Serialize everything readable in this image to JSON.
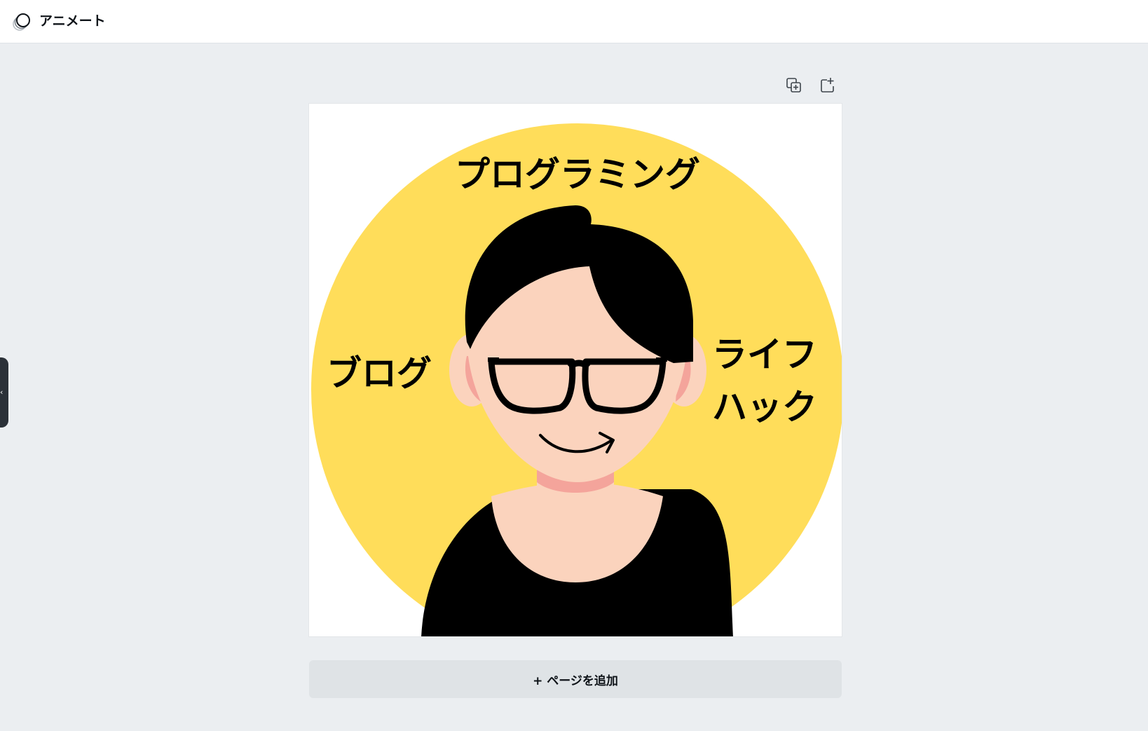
{
  "header": {
    "app_title": "アニメート",
    "logo_icon": "animate-logo-icon"
  },
  "sidebar": {
    "toggle_icon": "chevron-left-icon"
  },
  "page_toolbar": {
    "duplicate_icon": "duplicate-page-icon",
    "add_icon": "add-page-icon"
  },
  "design": {
    "text_top": "プログラミング",
    "text_left": "ブログ",
    "text_right_line1": "ライフ",
    "text_right_line2": "ハック",
    "colors": {
      "circle": "#ffdd5a",
      "skin": "#fbd3bd",
      "ear_inner": "#f4a49b",
      "neck_shadow": "#f4a49b",
      "hair": "#000000",
      "shirt": "#000000"
    }
  },
  "footer": {
    "add_page_label": "+ ページを追加"
  }
}
